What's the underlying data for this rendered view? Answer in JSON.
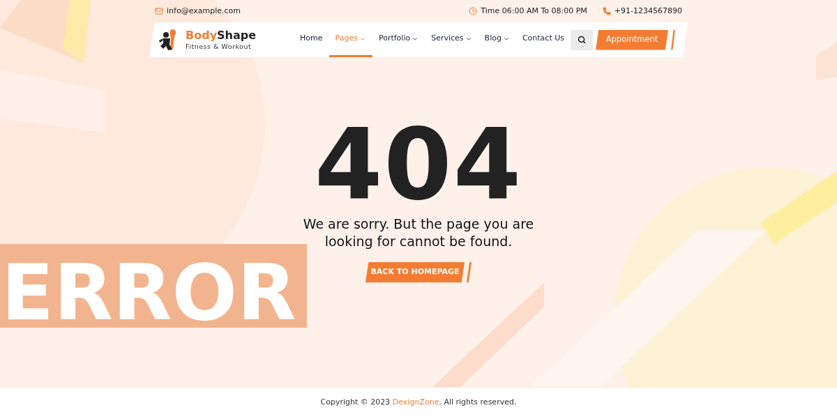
{
  "topbar": {
    "email": "info@example.com",
    "hours": "Time 06:00 AM To 08:00 PM",
    "phone": "+91-1234567890"
  },
  "header": {
    "logo": {
      "name_first": "Body",
      "name_second": "Shape",
      "tagline": "Fitness & Workout"
    },
    "nav": [
      {
        "label": "Home",
        "selected": false,
        "dropdown": false
      },
      {
        "label": "Pages",
        "selected": true,
        "dropdown": true
      },
      {
        "label": "Portfolio",
        "selected": false,
        "dropdown": true
      },
      {
        "label": "Services",
        "selected": false,
        "dropdown": true
      },
      {
        "label": "Blog",
        "selected": false,
        "dropdown": true
      },
      {
        "label": "Contact Us",
        "selected": false,
        "dropdown": false
      }
    ],
    "cta": "Appointment"
  },
  "error": {
    "background_word": "ERROR",
    "code": "404",
    "message": "We are sorry. But the page you are looking for cannot be found.",
    "button": "BACK TO HOMEPAGE"
  },
  "footer": {
    "before": "Copyright © 2023 ",
    "link": "DexignZone",
    "after": ". All rights reserved."
  }
}
